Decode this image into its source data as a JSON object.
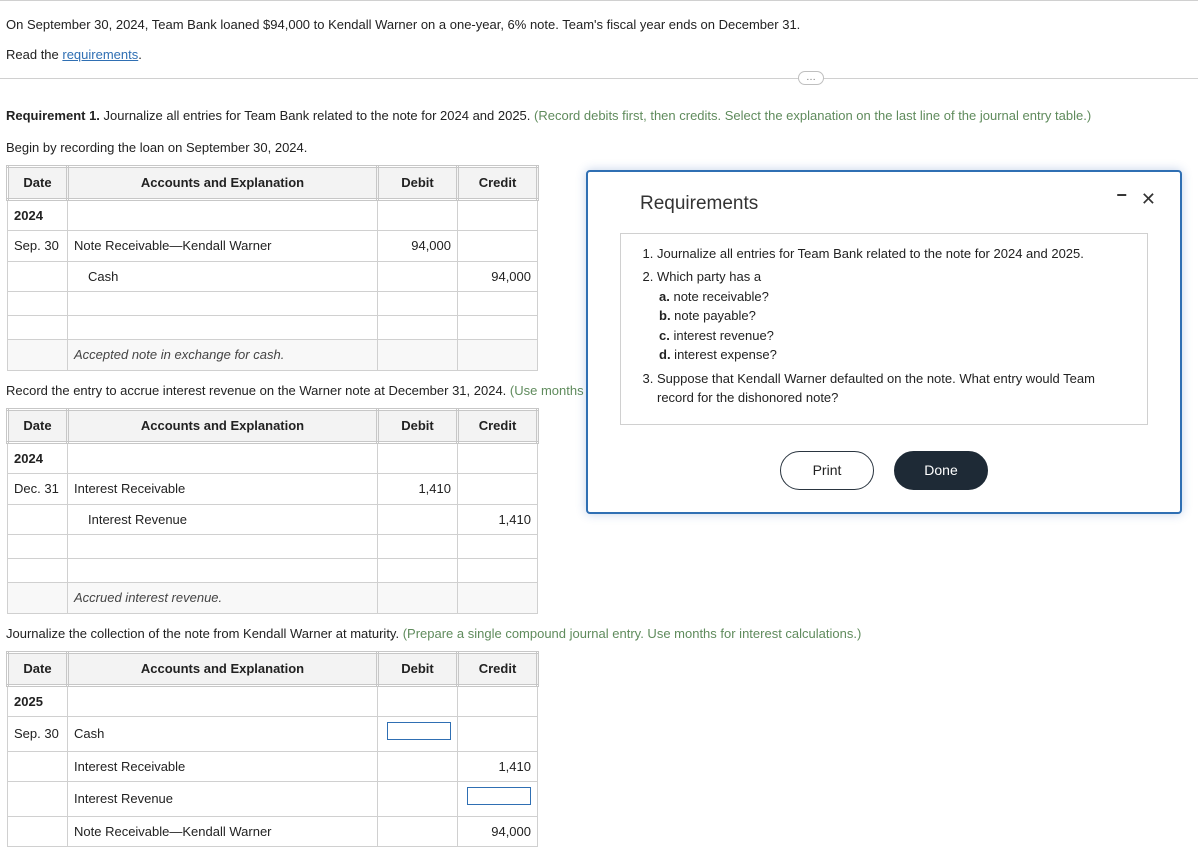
{
  "intro": {
    "scenario": "On September 30, 2024, Team Bank loaned $94,000 to Kendall Warner on a one-year, 6% note. Team's fiscal year ends on December 31.",
    "read_prefix": "Read the ",
    "requirements_link": "requirements",
    "read_suffix": "."
  },
  "ellipsis_label": "…",
  "req1": {
    "label": "Requirement 1.",
    "text": " Journalize all entries for Team Bank related to the note for 2024 and 2025. ",
    "hint": "(Record debits first, then credits. Select the explanation on the last line of the journal entry table.)"
  },
  "table_headers": {
    "date": "Date",
    "accounts": "Accounts and Explanation",
    "debit": "Debit",
    "credit": "Credit"
  },
  "section1": {
    "instruction": "Begin by recording the loan on September 30, 2024.",
    "year": "2024",
    "date": "Sep. 30",
    "rows": [
      {
        "acct": "Note Receivable—Kendall Warner",
        "debit": "94,000",
        "credit": ""
      },
      {
        "acct": "Cash",
        "debit": "",
        "credit": "94,000",
        "indent": true
      }
    ],
    "explanation": "Accepted note in exchange for cash."
  },
  "section2": {
    "instruction_pre": "Record the entry to accrue interest revenue on the Warner note at December 31, 2024. ",
    "instruction_hint": "(Use months",
    "year": "2024",
    "date": "Dec. 31",
    "rows": [
      {
        "acct": "Interest Receivable",
        "debit": "1,410",
        "credit": ""
      },
      {
        "acct": "Interest Revenue",
        "debit": "",
        "credit": "1,410",
        "indent": true
      }
    ],
    "explanation": "Accrued interest revenue."
  },
  "section3": {
    "instruction_pre": "Journalize the collection of the note from Kendall Warner at maturity. ",
    "instruction_hint": "(Prepare a single compound journal entry. Use months for interest calculations.)",
    "year": "2025",
    "date": "Sep. 30",
    "rows": [
      {
        "acct": "Cash",
        "debit_input": true,
        "credit": ""
      },
      {
        "acct": "Interest Receivable",
        "debit": "",
        "credit": "1,410"
      },
      {
        "acct": "Interest Revenue",
        "debit": "",
        "credit_input": true
      },
      {
        "acct": "Note Receivable—Kendall Warner",
        "debit": "",
        "credit": "94,000"
      }
    ]
  },
  "modal": {
    "title": "Requirements",
    "items": {
      "i1": "Journalize all entries for Team Bank related to the note for 2024 and 2025.",
      "i2": "Which party has a",
      "i2a": "a. note receivable?",
      "i2b": "b. note payable?",
      "i2c": "c. interest revenue?",
      "i2d": "d. interest expense?",
      "i3": "Suppose that Kendall Warner defaulted on the note. What entry would Team record for the dishonored note?"
    },
    "print": "Print",
    "done": "Done"
  }
}
